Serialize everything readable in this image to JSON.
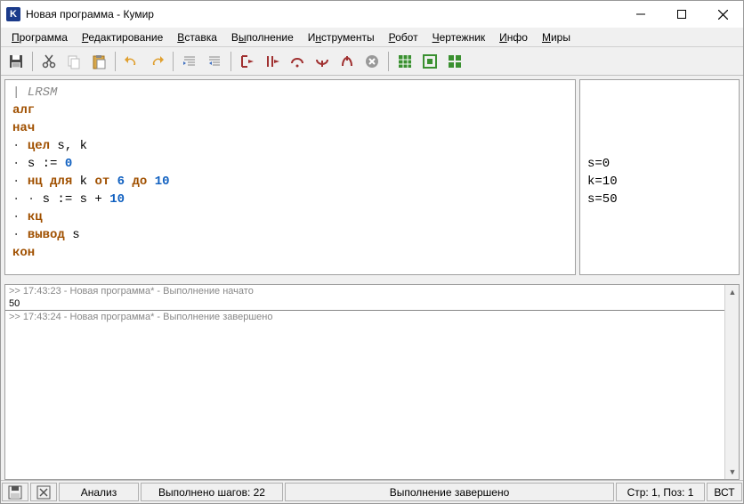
{
  "title": "Новая программа - Кумир",
  "menu": [
    "Программа",
    "Редактирование",
    "Вставка",
    "Выполнение",
    "Инструменты",
    "Робот",
    "Чертежник",
    "Инфо",
    "Миры"
  ],
  "menu_underline_index": [
    0,
    0,
    0,
    1,
    1,
    0,
    0,
    0,
    0
  ],
  "code": {
    "comment": "| LRSM",
    "l1": "алг",
    "l2": "нач",
    "l3_kw": "цел",
    "l3_rest": " s, k",
    "l4_a": "s := ",
    "l4_b": "0",
    "l5_a": "нц для",
    "l5_b": " k ",
    "l5_c": "от",
    "l5_d": " 6 ",
    "l5_e": "до",
    "l5_f": " 10",
    "l6_a": " s := s + ",
    "l6_b": "10",
    "l7": "кц",
    "l8_a": "вывод",
    "l8_b": " s",
    "l9": "кон"
  },
  "vars": [
    "s=0",
    "k=10",
    "s=50"
  ],
  "console": {
    "l1": ">> 17:43:23 - Новая программа* - Выполнение начато",
    "l2": "50",
    "l3": ">> 17:43:24 - Новая программа* - Выполнение завершено"
  },
  "status": {
    "analysis": "Анализ",
    "steps": "Выполнено шагов: 22",
    "state": "Выполнение завершено",
    "pos": "Стр: 1, Поз: 1",
    "mode": "ВСТ"
  }
}
